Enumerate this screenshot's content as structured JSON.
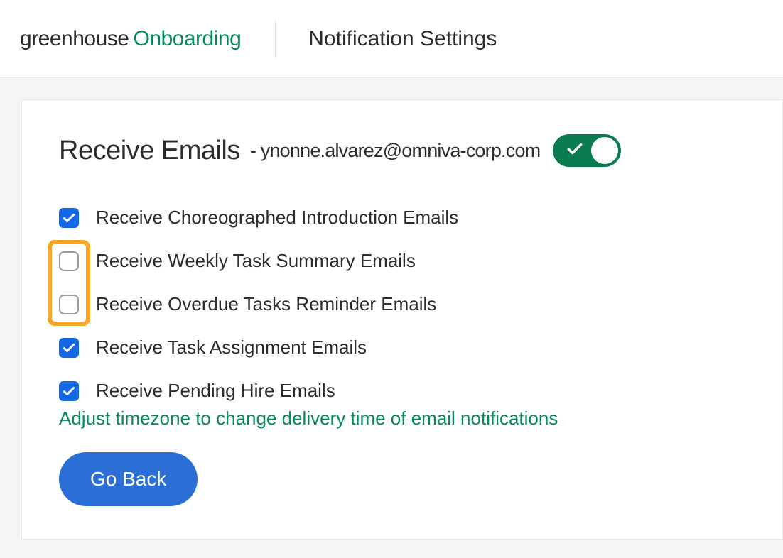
{
  "brand": {
    "a": "greenhouse",
    "b": "Onboarding"
  },
  "page_title": "Notification Settings",
  "heading": "Receive Emails",
  "heading_email": "- ynonne.alvarez@omniva-corp.com",
  "toggle_on": true,
  "options": [
    {
      "label": "Receive Choreographed Introduction Emails",
      "checked": true
    },
    {
      "label": "Receive Weekly Task Summary Emails",
      "checked": false
    },
    {
      "label": "Receive Overdue Tasks Reminder Emails",
      "checked": false
    },
    {
      "label": "Receive Task Assignment Emails",
      "checked": true
    },
    {
      "label": "Receive Pending Hire Emails",
      "checked": true
    }
  ],
  "tz_link": "Adjust timezone to change delivery time of email notifications",
  "go_back": "Go Back",
  "highlight": {
    "start_index": 1,
    "end_index": 2
  }
}
